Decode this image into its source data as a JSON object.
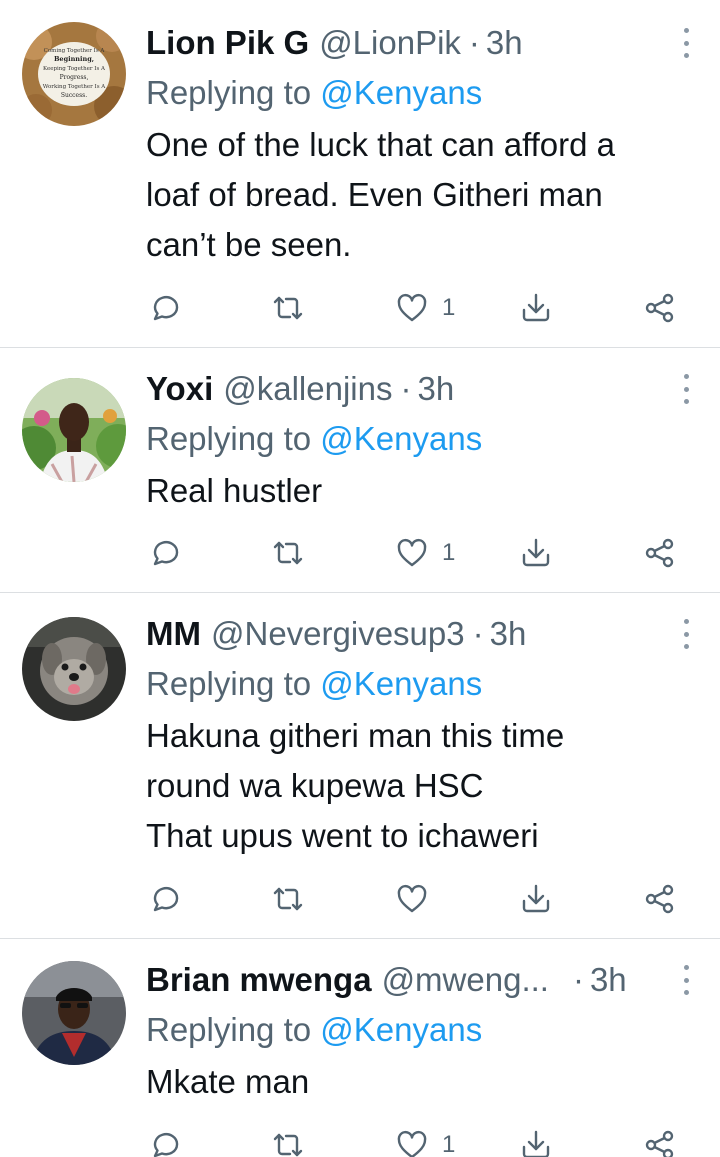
{
  "tweets": [
    {
      "name": "Lion Pik G",
      "handle": "@LionPik",
      "time": "3h",
      "replying_prefix": "Replying to",
      "replying_to": "@Kenyans",
      "text": "One of the luck that can afford a\nloaf of bread. Even Githeri man\ncan’t be seen.",
      "likes": "1",
      "avatar_text": [
        "Coming Together Is A",
        "Beginning,",
        "Keeping Together Is A",
        "Progress,",
        "Working Together Is A",
        "Success."
      ]
    },
    {
      "name": "Yoxi",
      "handle": "@kallenjins",
      "time": "3h",
      "replying_prefix": "Replying to",
      "replying_to": "@Kenyans",
      "text": "Real hustler",
      "likes": "1"
    },
    {
      "name": "MM",
      "handle": "@Nevergivesup3",
      "time": "3h",
      "replying_prefix": "Replying to",
      "replying_to": "@Kenyans",
      "text": "Hakuna githeri man this time\nround wa kupewa HSC\nThat upus went to ichaweri",
      "likes": ""
    },
    {
      "name": "Brian mwenga",
      "handle": "@mweng...",
      "time": "3h",
      "replying_prefix": "Replying to",
      "replying_to": "@Kenyans",
      "text": "Mkate man",
      "likes": "1"
    }
  ],
  "separator": "·",
  "icons": {
    "reply": "reply-icon",
    "retweet": "retweet-icon",
    "like": "heart-icon",
    "download": "download-icon",
    "share": "share-icon",
    "more": "more-vertical-icon"
  },
  "colors": {
    "link": "#1d9bf0",
    "secondary_text": "#536471",
    "icon": "#536471",
    "divider": "#dcdfe2"
  }
}
